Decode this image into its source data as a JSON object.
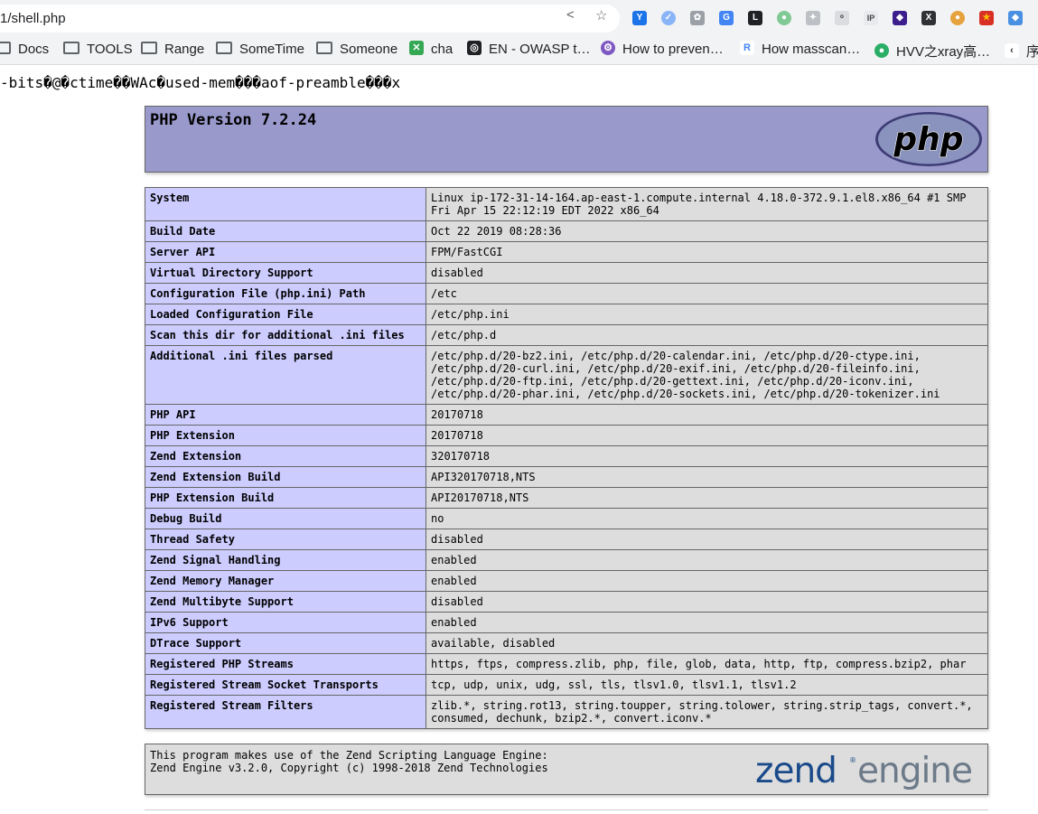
{
  "browser": {
    "url": "1/shell.php"
  },
  "bookmarks": [
    {
      "label": "Docs",
      "icon": "folder-icon"
    },
    {
      "label": "TOOLS",
      "icon": "folder-icon"
    },
    {
      "label": "Range",
      "icon": "folder-icon"
    },
    {
      "label": "SomeTime",
      "icon": "folder-icon"
    },
    {
      "label": "Someone",
      "icon": "folder-icon"
    },
    {
      "label": "cha",
      "icon": "site-icon"
    },
    {
      "label": "EN - OWASP t…",
      "icon": "site-icon"
    },
    {
      "label": "How to preven…",
      "icon": "site-icon"
    },
    {
      "label": "How masscan…",
      "icon": "site-icon"
    },
    {
      "label": "HVV之xray高…",
      "icon": "wechat-icon"
    },
    {
      "label": "序",
      "icon": "site-icon"
    }
  ],
  "garbage_text": "-bits�@�\u0007ctime��WAc�\u0007used-mem��\u0007�\u0007aof-preamble���\u0007\u0007x\u0007",
  "php": {
    "version_title": "PHP Version 7.2.24",
    "logo_text": "php",
    "rows": [
      {
        "key": "System",
        "value": "Linux ip-172-31-14-164.ap-east-1.compute.internal 4.18.0-372.9.1.el8.x86_64 #1 SMP Fri Apr 15 22:12:19 EDT 2022 x86_64"
      },
      {
        "key": "Build Date",
        "value": "Oct 22 2019 08:28:36"
      },
      {
        "key": "Server API",
        "value": "FPM/FastCGI"
      },
      {
        "key": "Virtual Directory Support",
        "value": "disabled"
      },
      {
        "key": "Configuration File (php.ini) Path",
        "value": "/etc"
      },
      {
        "key": "Loaded Configuration File",
        "value": "/etc/php.ini"
      },
      {
        "key": "Scan this dir for additional .ini files",
        "value": "/etc/php.d"
      },
      {
        "key": "Additional .ini files parsed",
        "value": "/etc/php.d/20-bz2.ini, /etc/php.d/20-calendar.ini, /etc/php.d/20-ctype.ini, /etc/php.d/20-curl.ini, /etc/php.d/20-exif.ini, /etc/php.d/20-fileinfo.ini, /etc/php.d/20-ftp.ini, /etc/php.d/20-gettext.ini, /etc/php.d/20-iconv.ini, /etc/php.d/20-phar.ini, /etc/php.d/20-sockets.ini, /etc/php.d/20-tokenizer.ini"
      },
      {
        "key": "PHP API",
        "value": "20170718"
      },
      {
        "key": "PHP Extension",
        "value": "20170718"
      },
      {
        "key": "Zend Extension",
        "value": "320170718"
      },
      {
        "key": "Zend Extension Build",
        "value": "API320170718,NTS"
      },
      {
        "key": "PHP Extension Build",
        "value": "API20170718,NTS"
      },
      {
        "key": "Debug Build",
        "value": "no"
      },
      {
        "key": "Thread Safety",
        "value": "disabled"
      },
      {
        "key": "Zend Signal Handling",
        "value": "enabled"
      },
      {
        "key": "Zend Memory Manager",
        "value": "enabled"
      },
      {
        "key": "Zend Multibyte Support",
        "value": "disabled"
      },
      {
        "key": "IPv6 Support",
        "value": "enabled"
      },
      {
        "key": "DTrace Support",
        "value": "available, disabled"
      },
      {
        "key": "Registered PHP Streams",
        "value": "https, ftps, compress.zlib, php, file, glob, data, http, ftp, compress.bzip2, phar"
      },
      {
        "key": "Registered Stream Socket Transports",
        "value": "tcp, udp, unix, udg, ssl, tls, tlsv1.0, tlsv1.1, tlsv1.2"
      },
      {
        "key": "Registered Stream Filters",
        "value": "zlib.*, string.rot13, string.toupper, string.tolower, string.strip_tags, convert.*, consumed, dechunk, bzip2.*, convert.iconv.*"
      }
    ]
  },
  "zend": {
    "line1": "This program makes use of the Zend Scripting Language Engine:",
    "line2": "Zend Engine v3.2.0, Copyright (c) 1998-2018 Zend Technologies",
    "logo_word1": "zend",
    "logo_word2": "engine",
    "logo_mark": "®"
  },
  "colors": {
    "header_bg": "#9999cc",
    "key_bg": "#ccccff",
    "value_bg": "#dddddd"
  }
}
